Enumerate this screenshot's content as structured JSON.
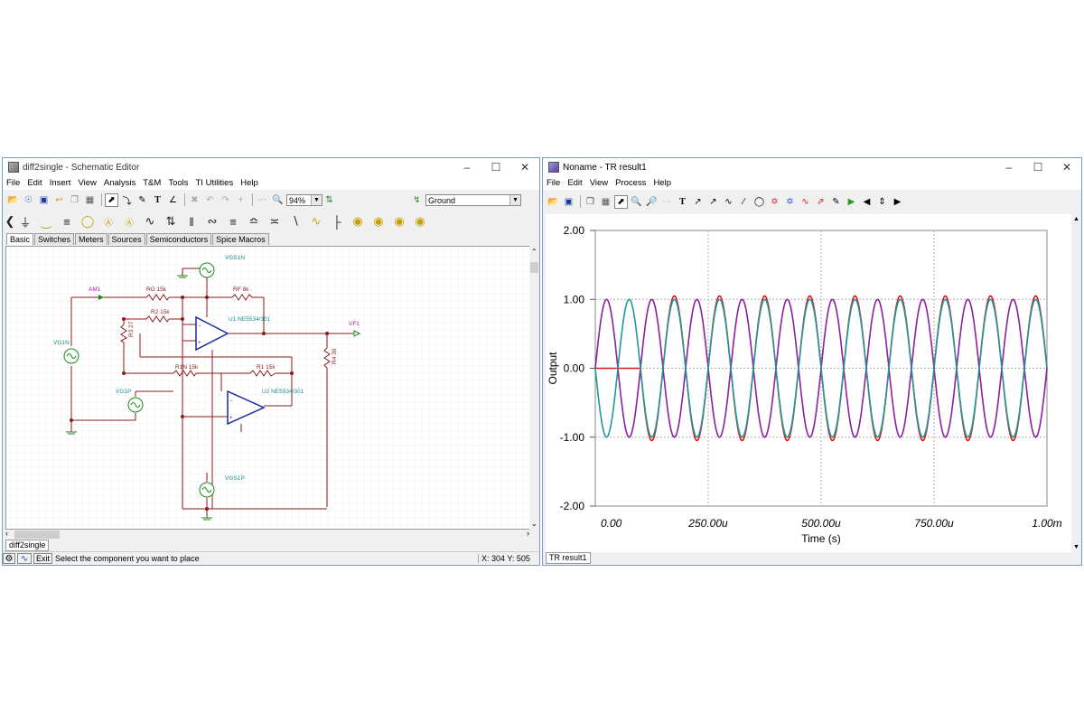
{
  "left_window": {
    "title": "diff2single - Schematic Editor",
    "menu": [
      "File",
      "Edit",
      "Insert",
      "View",
      "Analysis",
      "T&M",
      "Tools",
      "TI Utilities",
      "Help"
    ],
    "zoom": "94%",
    "ground_combo": "Ground",
    "component_tabs": [
      "Basic",
      "Switches",
      "Meters",
      "Sources",
      "Semiconductors",
      "Spice Macros"
    ],
    "active_tab": "Basic",
    "schematic_labels": {
      "vgs1n": "VGS1N",
      "am1": "AM1",
      "rg": "RG 15k",
      "rf": "RF 8k",
      "r2": "R2 15k",
      "r3": "R3 27",
      "u1": "U1 NE5534/301",
      "vf1": "VF1",
      "vg1n": "VG1N",
      "r4": "R4 30",
      "r1n": "R1N 15k",
      "r1": "R1 15k",
      "vg1p": "VG1P",
      "u2": "U2 NE5534/301",
      "vgs1p": "VGS1P"
    },
    "bottom_tab": "diff2single",
    "status_text": "Select the component you want to place",
    "exit_label": "Exit",
    "coords": "X: 304  Y: 505"
  },
  "right_window": {
    "title": "Noname - TR result1",
    "menu": [
      "File",
      "Edit",
      "View",
      "Process",
      "Help"
    ],
    "bottom_tab": "TR result1"
  },
  "chart_data": {
    "type": "line",
    "xlabel": "Time (s)",
    "ylabel": "Output",
    "xlim": [
      0,
      0.001
    ],
    "ylim": [
      -2,
      2
    ],
    "x_tick_labels": [
      "0.00",
      "250.00u",
      "500.00u",
      "750.00u",
      "1.00m"
    ],
    "y_tick_labels": [
      "2.00",
      "1.00",
      "0.00",
      "-1.00",
      "-2.00"
    ],
    "grid": true,
    "frequency_hz": 10000,
    "series": [
      {
        "color": "#e01818",
        "amplitude": 1.05,
        "phase": "negative sine",
        "start_delay_s": 0.0001,
        "description": "flat at 0 until 100u"
      },
      {
        "color": "#8a1fa0",
        "amplitude": 1.0,
        "phase": "positive sine"
      },
      {
        "color": "#1e9a9a",
        "amplitude": 1.0,
        "phase": "negative sine"
      }
    ]
  },
  "colors": {
    "wire": "#8b1a1a",
    "label_teal": "#1a8a8a",
    "label_purple": "#a020a0",
    "opamp": "#1a2aa0",
    "source": "#1a8a1a"
  }
}
